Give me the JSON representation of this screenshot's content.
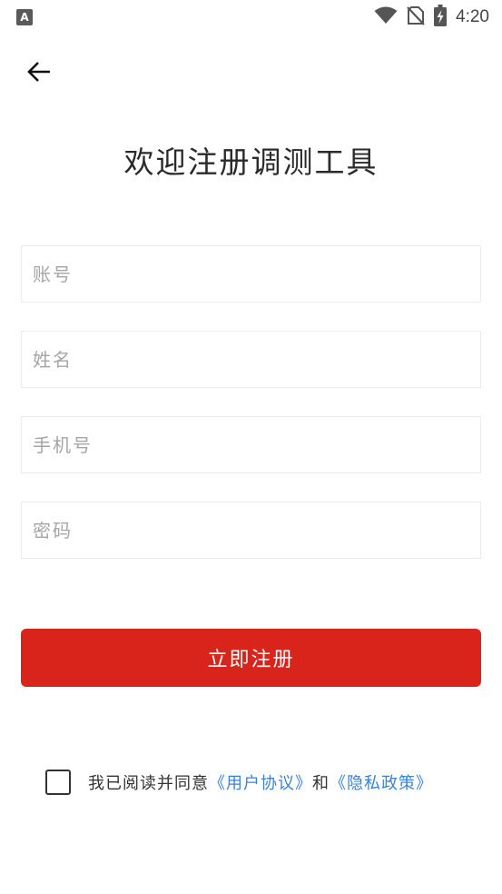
{
  "status_bar": {
    "time": "4:20",
    "notify_badge": "A",
    "icons": [
      "wifi-icon",
      "no-sim-icon",
      "battery-charging-icon"
    ]
  },
  "header": {
    "back_icon": "arrow-left-icon"
  },
  "title": "欢迎注册调测工具",
  "form": {
    "account": {
      "placeholder": "账号",
      "value": ""
    },
    "name": {
      "placeholder": "姓名",
      "value": ""
    },
    "phone": {
      "placeholder": "手机号",
      "value": ""
    },
    "password": {
      "placeholder": "密码",
      "value": ""
    }
  },
  "register_label": "立即注册",
  "agreement": {
    "checked": false,
    "prefix": "我已阅读并同意",
    "user_agreement": "《用户协议》",
    "and": "和",
    "privacy_policy": "《隐私政策》"
  },
  "colors": {
    "primary": "#d9241b",
    "link": "#3b82d6",
    "placeholder": "#a5a5a5",
    "field_border": "#ececec"
  }
}
